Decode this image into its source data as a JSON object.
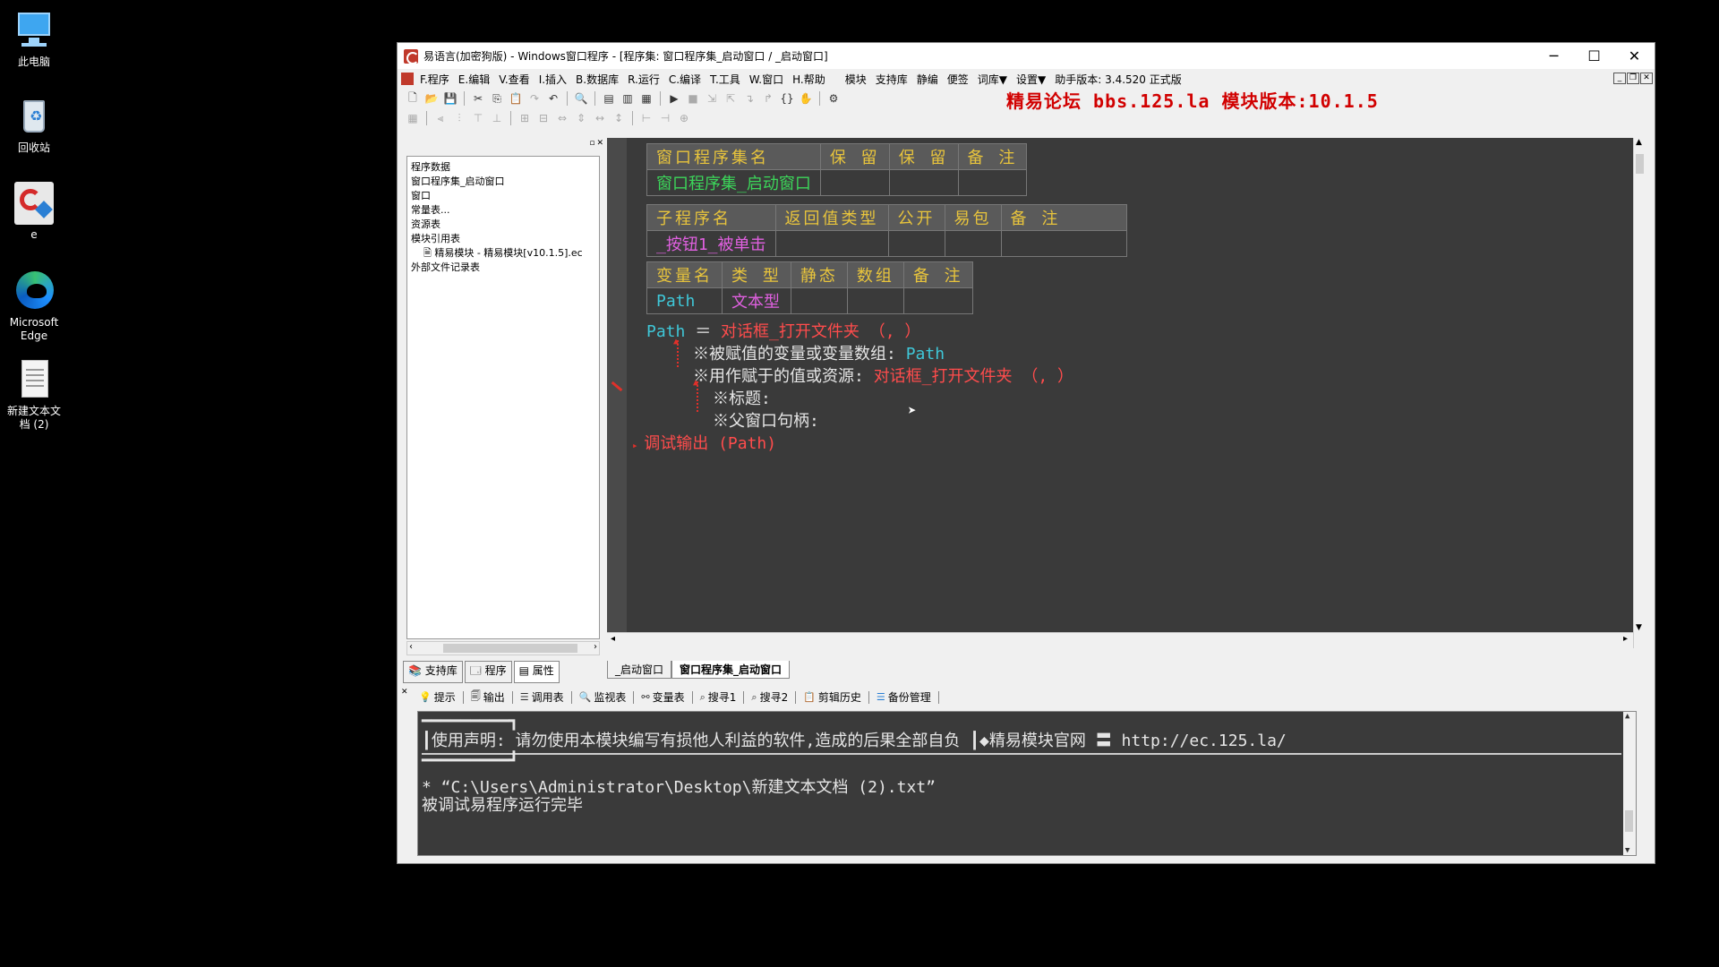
{
  "desktop": {
    "icons": [
      {
        "label": "此电脑"
      },
      {
        "label": "回收站"
      },
      {
        "label": "e"
      },
      {
        "label": "Microsoft Edge"
      },
      {
        "label": "新建文本文档 (2)"
      }
    ]
  },
  "window": {
    "title": "易语言(加密狗版) - Windows窗口程序 - [程序集: 窗口程序集_启动窗口 / _启动窗口]",
    "minimize": "─",
    "maximize": "☐",
    "close": "✕"
  },
  "menu": {
    "items": [
      "F.程序",
      "E.编辑",
      "V.查看",
      "I.插入",
      "B.数据库",
      "R.运行",
      "C.编译",
      "T.工具",
      "W.窗口",
      "H.帮助",
      "模块",
      "支持库",
      "静编",
      "便签",
      "词库▼",
      "设置▼",
      "助手版本: 3.4.520 正式版"
    ]
  },
  "banner": "精易论坛 bbs.125.la 模块版本:10.1.5",
  "tree": {
    "items": [
      "程序数据",
      "窗口程序集_启动窗口",
      "窗口",
      "常量表...",
      "资源表",
      "模块引用表",
      "精易模块 - 精易模块[v10.1.5].ec",
      "外部文件记录表"
    ]
  },
  "left_tabs": [
    "支持库",
    "程序",
    "属性"
  ],
  "editor": {
    "assembly_table": {
      "headers": [
        "窗口程序集名",
        "保 留",
        "保 留",
        "备 注"
      ],
      "row": [
        "窗口程序集_启动窗口",
        "",
        "",
        ""
      ]
    },
    "sub_table": {
      "headers": [
        "子程序名",
        "返回值类型",
        "公开",
        "易包",
        "备 注"
      ],
      "row": [
        "_按钮1_被单击",
        "",
        "",
        "",
        ""
      ]
    },
    "var_table": {
      "headers": [
        "变量名",
        "类 型",
        "静态",
        "数组",
        "备 注"
      ],
      "row": [
        "Path",
        "文本型",
        "",
        "",
        ""
      ]
    },
    "code": {
      "line1_var": "Path",
      "line1_op": " ＝ ",
      "line1_func": "对话框_打开文件夹 （, ）",
      "line2_label": "※被赋值的变量或变量数组:",
      "line2_val": "Path",
      "line3_label": "※用作赋于的值或资源:",
      "line3_val": "对话框_打开文件夹 （, ）",
      "line4": "※标题:",
      "line5": "※父窗口句柄:",
      "line6_func": "调试输出 (Path)"
    }
  },
  "editor_tabs": [
    "_启动窗口",
    "窗口程序集_启动窗口"
  ],
  "output_tabs": [
    "提示",
    "输出",
    "调用表",
    "监视表",
    "变量表",
    "搜寻1",
    "搜寻2",
    "剪辑历史",
    "备份管理"
  ],
  "output": {
    "line_top": "━━━━━━━━━┓",
    "notice": "┃使用声明: 请勿使用本模块编写有损他人利益的软件,造成的后果全部自负 ┃◆精易模块官网  〓 http://ec.125.la/",
    "line_bottom": "━━━━━━━━━┛",
    "path_line": "* “C:\\Users\\Administrator\\Desktop\\新建文本文档 (2).txt”",
    "done_line": "被调试易程序运行完毕"
  }
}
